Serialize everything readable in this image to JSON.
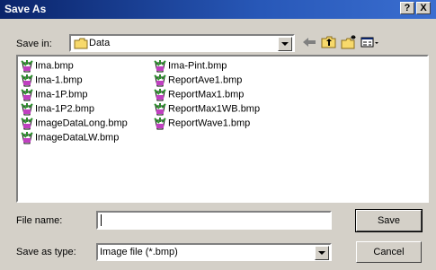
{
  "window": {
    "title": "Save As",
    "help_button": "?",
    "close_button": "X"
  },
  "save_in": {
    "label": "Save in:",
    "value": "Data"
  },
  "toolbar": {
    "icons": [
      "back-arrow-icon",
      "up-folder-icon",
      "new-folder-icon",
      "view-menu-icon"
    ]
  },
  "files": {
    "column1": [
      "Ima.bmp",
      "Ima-1.bmp",
      "Ima-1P.bmp",
      "Ima-1P2.bmp",
      "ImageDataLong.bmp",
      "ImageDataLW.bmp"
    ],
    "column2": [
      "Ima-Pint.bmp",
      "ReportAve1.bmp",
      "ReportMax1.bmp",
      "ReportMax1WB.bmp",
      "ReportWave1.bmp"
    ]
  },
  "file_name": {
    "label": "File name:",
    "value": ""
  },
  "save_as_type": {
    "label": "Save as type:",
    "value": "Image file (*.bmp)"
  },
  "buttons": {
    "save": "Save",
    "cancel": "Cancel"
  }
}
